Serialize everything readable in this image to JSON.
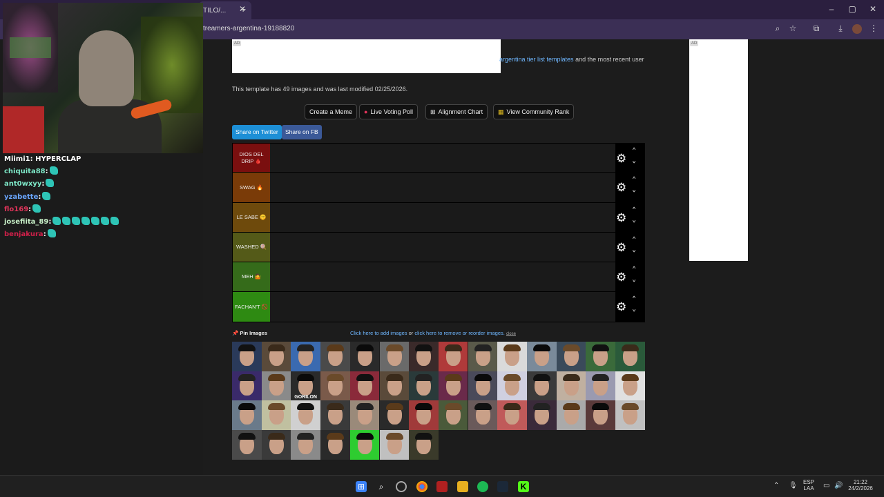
{
  "browser": {
    "tab_title": "TILO/...",
    "tab_close": "✕",
    "new_tab": "+",
    "url": "treamers-argentina-19188820",
    "window_controls": [
      "–",
      "▢",
      "✕"
    ],
    "toolbar_icons": [
      "zoom-icon",
      "star-icon",
      "extensions-icon",
      "download-icon",
      "profile-avatar",
      "menu-icon"
    ]
  },
  "chat": [
    {
      "user": "Miimi1",
      "color": "#ffffff",
      "message": " HYPERCLAP",
      "emotes": 0
    },
    {
      "user": "chiquita88",
      "color": "#7ee8c8",
      "message": "",
      "emotes": 1
    },
    {
      "user": "ant0wxyy",
      "color": "#7ee8c8",
      "message": "",
      "emotes": 1
    },
    {
      "user": "yzabette",
      "color": "#6aa6ff",
      "message": "",
      "emotes": 1
    },
    {
      "user": "flo169",
      "color": "#e0345a",
      "message": "",
      "emotes": 1
    },
    {
      "user": "josefiita_89",
      "color": "#c8f0c8",
      "message": "",
      "emotes": 7
    },
    {
      "user": "benjakura",
      "color": "#d0204a",
      "message": "",
      "emotes": 1
    }
  ],
  "page": {
    "ad_label": "AD",
    "intro_link": "argentina tier list templates",
    "intro_rest": " and the most recent user",
    "meta": "This template has 49 images and was last modified 02/25/2026.",
    "buttons": {
      "create_meme": "Create a Meme",
      "live_poll": "Live Voting Poll",
      "alignment": "Alignment Chart",
      "community_rank": "View Community Rank"
    },
    "share_twitter": "Share on Twitter",
    "share_fb": "Share on FB",
    "tiers": [
      {
        "label": "DIOS DEL DRIP 🩸",
        "color": "#7a0f0f"
      },
      {
        "label": "SWAG 🔥",
        "color": "#7a3b08"
      },
      {
        "label": "LE SABE 🤫",
        "color": "#6e4a0c"
      },
      {
        "label": "WASHED 🍭",
        "color": "#545a18"
      },
      {
        "label": "MEH 🤷",
        "color": "#356b1a"
      },
      {
        "label": "FACHAN'T 🚫",
        "color": "#2e8a12"
      }
    ],
    "pin_images": "📌 Pin Images",
    "add_images_link": "Click here to add images",
    "or_text": " or ",
    "remove_link": "click here to remove or reorder images.",
    "close": "close",
    "gorilon_label": "GORILON"
  },
  "taskbar": {
    "lang": "ESP",
    "layout": "LAA",
    "time": "21:22",
    "date": "24/2/2026"
  }
}
